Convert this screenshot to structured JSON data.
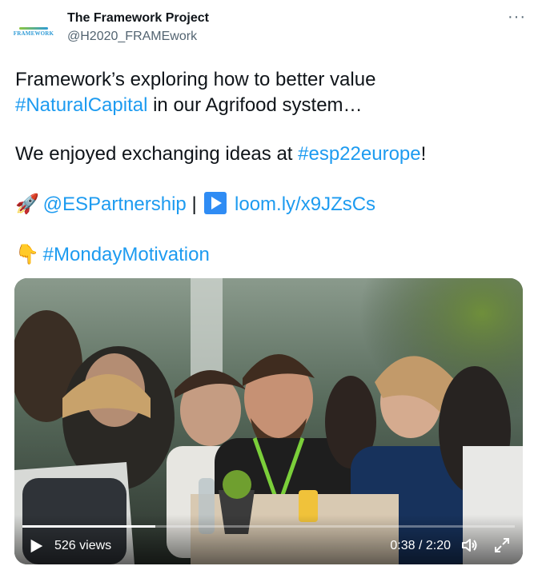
{
  "account": {
    "name": "The Framework Project",
    "handle": "@H2020_FRAMEwork",
    "avatar_text": "FRAMEWORK"
  },
  "tweet": {
    "line1_text": "Framework’s exploring how to better value",
    "line2_link": "#NaturalCapital",
    "line2_text": " in our Agrifood system…",
    "line3_text": "We enjoyed exchanging ideas at ",
    "line3_link": "#esp22europe",
    "line3_end": "!",
    "line4_emoji": "🚀",
    "line4_link1": "@ESPartnership",
    "line4_sep": " | ",
    "line4_link2": "loom.ly/x9JZsCs",
    "line5_emoji": "👇",
    "line5_link": "#MondayMotivation"
  },
  "video": {
    "views": "526 views",
    "time": "0:38 / 2:20",
    "progress": 0.27
  },
  "icons": {
    "more": "more-icon",
    "play": "play-icon",
    "volume": "volume-icon",
    "fullscreen": "fullscreen-icon"
  }
}
